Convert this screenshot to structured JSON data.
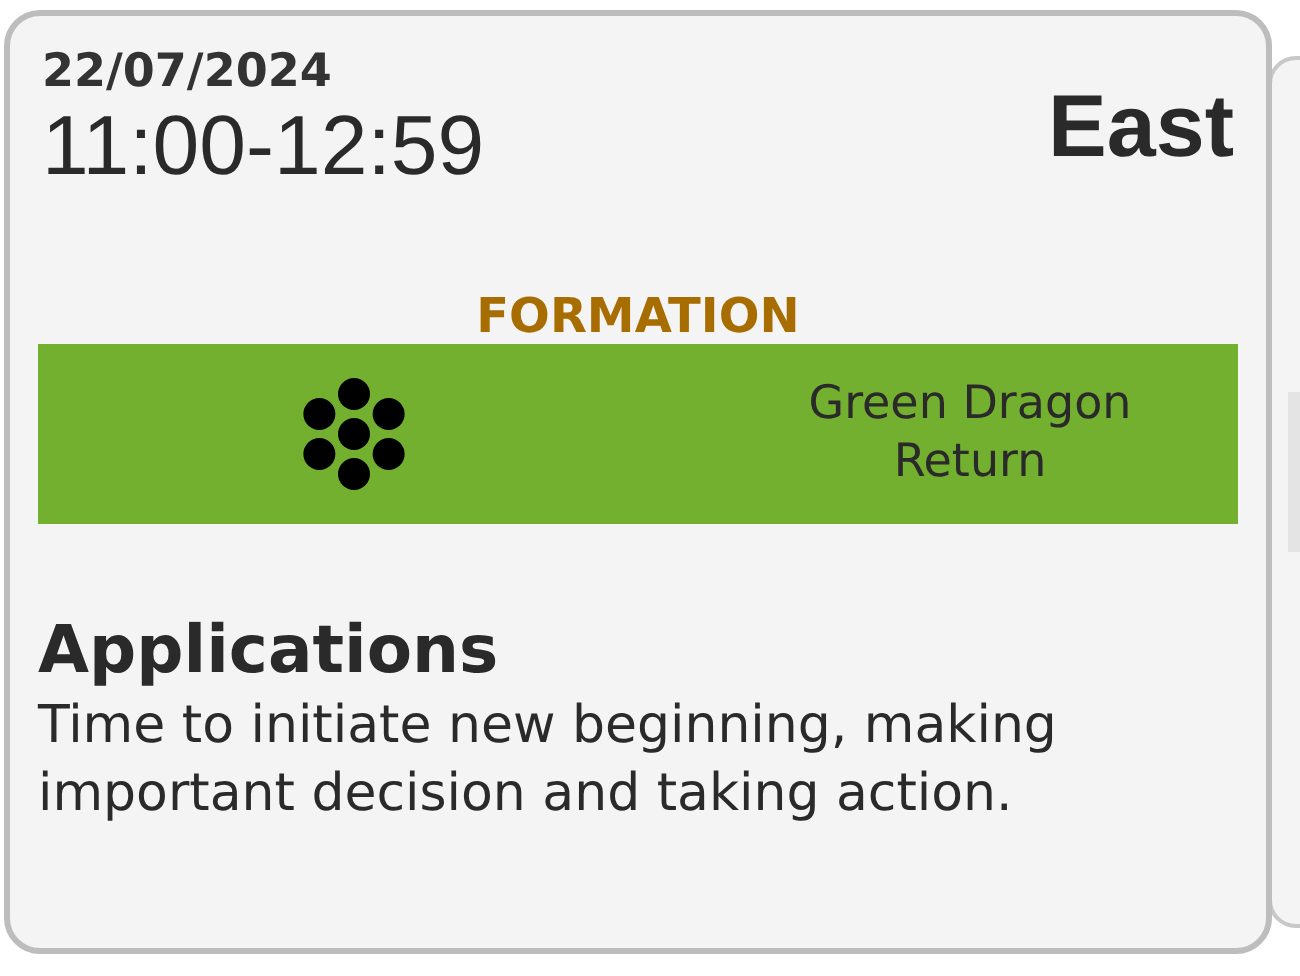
{
  "card": {
    "date": "22/07/2024",
    "time": "11:00-12:59",
    "direction": "East",
    "formation": {
      "label": "FORMATION",
      "name": "Green Dragon Return",
      "color": "#74b02f"
    },
    "applications": {
      "title": "Applications",
      "text": "Time to initiate new beginning, making important decision and taking action."
    }
  }
}
